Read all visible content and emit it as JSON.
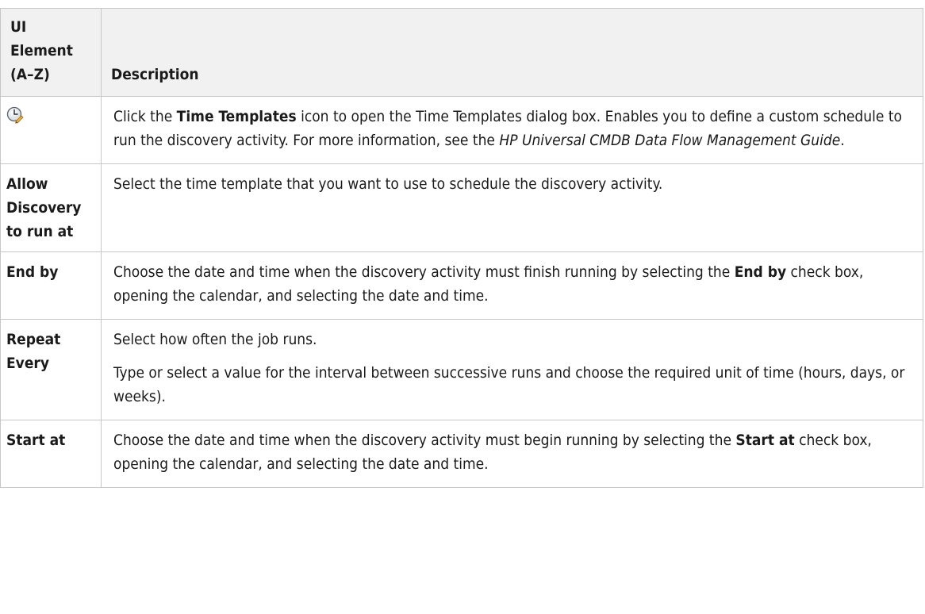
{
  "header": {
    "ui_element": "UI Element (A–Z)",
    "description": "Description"
  },
  "rows": [
    {
      "icon": "time-templates-icon",
      "description": {
        "p1_a": "Click the ",
        "p1_b": "Time Templates",
        "p1_c": " icon to open the Time Templates dialog box. Enables you to define a custom schedule to run the discovery activity. For more information, see the ",
        "p1_d": "HP Universal CMDB Data Flow Management Guide",
        "p1_e": "."
      }
    },
    {
      "element": "Allow Discovery to run at",
      "description": {
        "p1": "Select the time template that you want to use to schedule the discovery activity."
      }
    },
    {
      "element": "End by",
      "description": {
        "p1_a": "Choose the date and time when the discovery activity must finish running by selecting the ",
        "p1_b": "End by",
        "p1_c": " check box, opening the calendar, and selecting the date and time."
      }
    },
    {
      "element": "Repeat Every",
      "description": {
        "p1": "Select how often the job runs.",
        "p2": "Type or select a value for the interval between successive runs and choose the required unit of time (hours, days, or weeks)."
      }
    },
    {
      "element": "Start at",
      "description": {
        "p1_a": "Choose the date and time when the discovery activity must begin running by selecting the ",
        "p1_b": "Start at",
        "p1_c": " check box, opening the calendar, and selecting the date and time."
      }
    }
  ]
}
